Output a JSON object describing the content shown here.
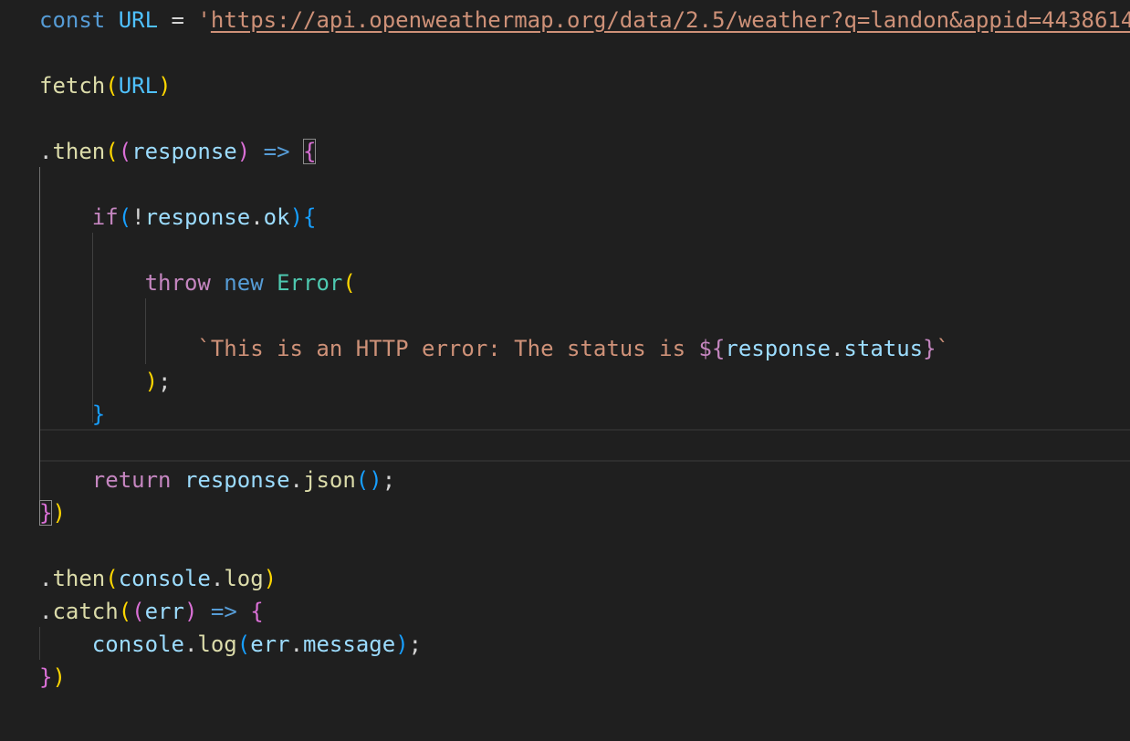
{
  "editor": {
    "language": "javascript",
    "theme_colors": {
      "background": "#1f1f1f",
      "keyword": "#569cd6",
      "control": "#c586c0",
      "constant": "#4fc1ff",
      "string": "#ce9178",
      "function": "#dcdcaa",
      "variable": "#9cdcfe",
      "class": "#4ec9b0",
      "bracket_1": "#ffd700",
      "bracket_2": "#da70d6",
      "bracket_3": "#179fff"
    },
    "code": {
      "l1": {
        "const_kw": "const",
        "url_name": "URL",
        "equals": "=",
        "quote": "'",
        "url_value": "https://api.openweathermap.org/data/2.5/weather?q=landon&appid=4438614"
      },
      "l2": {
        "fetch": "fetch",
        "open": "(",
        "arg": "URL",
        "close": ")"
      },
      "l3": {
        "dot": ".",
        "then": "then",
        "open": "(",
        "open_params": "(",
        "param": "response",
        "close_params": ")",
        "arrow": "=>",
        "brace": "{"
      },
      "l4": {
        "if_kw": "if",
        "open": "(",
        "not": "!",
        "obj": "response",
        "dot": ".",
        "prop": "ok",
        "close": ")",
        "brace": "{"
      },
      "l5": {
        "throw_kw": "throw",
        "new_kw": "new",
        "cls": "Error",
        "open": "("
      },
      "l6": {
        "tpl_text": "`This is an HTTP error: The status is ",
        "tpl_open": "${",
        "obj": "response",
        "dot": ".",
        "prop": "status",
        "tpl_close": "}",
        "tpl_end": "`"
      },
      "l7": {
        "close": ")",
        "semi": ";"
      },
      "l8": {
        "brace": "}"
      },
      "l9": {
        "return_kw": "return",
        "obj": "response",
        "dot": ".",
        "fn": "json",
        "open": "(",
        "close": ")",
        "semi": ";"
      },
      "l10": {
        "brace": "}",
        "close": ")"
      },
      "l11": {
        "dot": ".",
        "then": "then",
        "open": "(",
        "obj": "console",
        "dot2": ".",
        "fn": "log",
        "close": ")"
      },
      "l12": {
        "dot": ".",
        "catch": "catch",
        "open": "(",
        "open_params": "(",
        "param": "err",
        "close_params": ")",
        "arrow": "=>",
        "brace": "{"
      },
      "l13": {
        "obj": "console",
        "dot": ".",
        "fn": "log",
        "open": "(",
        "arg": "err",
        "dot2": ".",
        "prop": "message",
        "close": ")",
        "semi": ";"
      },
      "l14": {
        "brace": "}",
        "close": ")"
      }
    }
  }
}
